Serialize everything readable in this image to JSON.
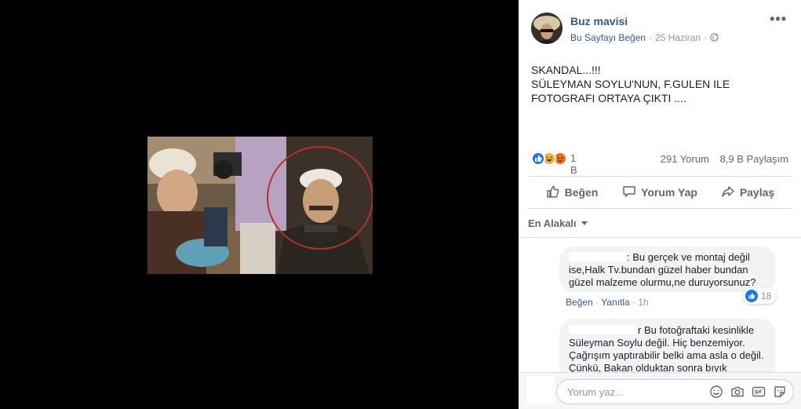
{
  "post": {
    "page_name": "Buz mavisi",
    "like_page": "Bu Sayfayı Beğen",
    "date": "25 Haziran",
    "text_lines": [
      "SKANDAL...!!!",
      "SÜLEYMAN SOYLU'NUN, F.GULEN ILE",
      "FOTOGRAFI ORTAYA ÇIKTI ...."
    ]
  },
  "stats": {
    "reactions": "1 B",
    "comments": "291 Yorum",
    "shares": "8,9 B Paylaşım"
  },
  "actions": {
    "like": "Beğen",
    "comment": "Yorum Yap",
    "share": "Paylaş"
  },
  "sort": {
    "label": "En Alakalı"
  },
  "comments": [
    {
      "text": ": Bu gerçek ve montaj değil ise,Halk Tv.bundan güzel haber bundan güzel malzeme olurmu,ne duruyorsunuz?",
      "like": "Beğen",
      "reply": "Yanıtla",
      "time": "1h",
      "reaction_count": "18"
    },
    {
      "text": "r Bu fotoğraftaki kesinlikle Süleyman Soylu değil. Hiç benzemiyor. Çağrışım yaptırabilir belki ama asla o değil. Çünkü, Bakan olduktan sonra bıyık"
    }
  ],
  "composer": {
    "placeholder": "Yorum yaz..."
  },
  "colors": {
    "link": "#365899",
    "like_blue": "#1877f2",
    "circle": "#b5302a"
  }
}
